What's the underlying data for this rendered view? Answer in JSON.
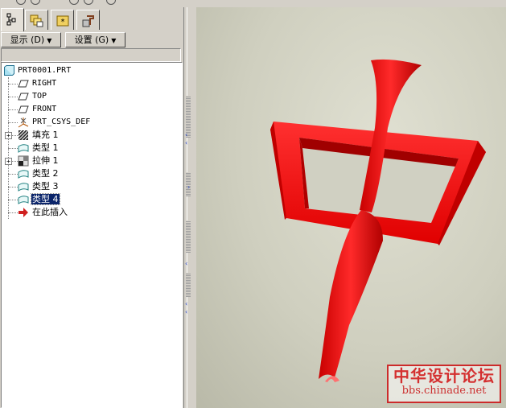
{
  "menubar": {
    "display_label": "显示 (D)",
    "settings_label": "设置 (G)"
  },
  "tree": {
    "root": "PRT0001.PRT",
    "items": [
      {
        "label": "RIGHT",
        "icon": "datum-plane-icon"
      },
      {
        "label": "TOP",
        "icon": "datum-plane-icon"
      },
      {
        "label": "FRONT",
        "icon": "datum-plane-icon"
      },
      {
        "label": "PRT_CSYS_DEF",
        "icon": "csys-icon"
      },
      {
        "label": "填充 1",
        "icon": "fill-icon",
        "expandable": true
      },
      {
        "label": "类型 1",
        "icon": "surface-icon"
      },
      {
        "label": "拉伸 1",
        "icon": "extrude-icon",
        "expandable": true
      },
      {
        "label": "类型 2",
        "icon": "surface-icon"
      },
      {
        "label": "类型 3",
        "icon": "surface-icon"
      },
      {
        "label": "类型 4",
        "icon": "surface-icon",
        "selected": true
      },
      {
        "label": "在此插入",
        "icon": "insert-here-arrow-icon"
      }
    ]
  },
  "viewport": {
    "model_color": "#ff1a1a",
    "background": "#d2d2c4"
  },
  "watermark": {
    "title": "中华设计论坛",
    "url": "bbs.chinade.net"
  }
}
